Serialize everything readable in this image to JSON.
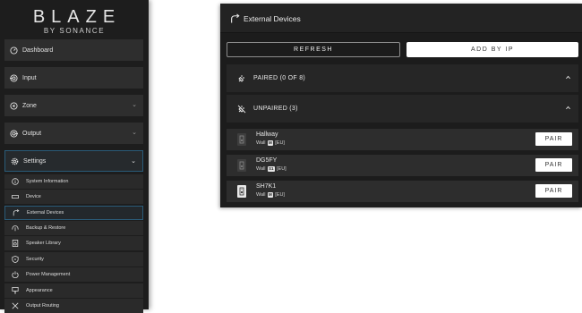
{
  "sidebar": {
    "logo": {
      "brand": "BLAZE",
      "sub": "BY SONANCE"
    },
    "nav": [
      {
        "label": "Dashboard",
        "icon": "dashboard-icon"
      },
      {
        "label": "Input",
        "icon": "input-icon"
      },
      {
        "label": "Zone",
        "icon": "zone-icon",
        "has_chevron": true
      },
      {
        "label": "Output",
        "icon": "output-icon",
        "has_chevron": true
      },
      {
        "label": "Settings",
        "icon": "settings-gear-icon",
        "has_chevron": true,
        "expanded": true
      }
    ],
    "settings_items": [
      {
        "label": "System Information",
        "icon": "info-icon"
      },
      {
        "label": "Device",
        "icon": "device-icon"
      },
      {
        "label": "External Devices",
        "icon": "external-devices-icon",
        "active": true
      },
      {
        "label": "Backup & Restore",
        "icon": "backup-restore-icon"
      },
      {
        "label": "Speaker Library",
        "icon": "speaker-library-icon"
      },
      {
        "label": "Security",
        "icon": "security-shield-icon"
      },
      {
        "label": "Power Management",
        "icon": "power-icon"
      },
      {
        "label": "Appearance",
        "icon": "appearance-icon"
      },
      {
        "label": "Output Routing",
        "icon": "output-routing-icon"
      }
    ]
  },
  "panel": {
    "title": "External Devices",
    "refresh_label": "REFRESH",
    "add_by_ip_label": "ADD BY IP",
    "paired_label": "PAIRED (0 OF 8)",
    "unpaired_label": "UNPAIRED (3)",
    "devices": [
      {
        "name": "Hallway",
        "type": "Wall",
        "tag": "M",
        "region": "[EU]",
        "pair_label": "PAIR"
      },
      {
        "name": "DG5FY",
        "type": "Wall",
        "tag": "S1",
        "region": "[EU]",
        "pair_label": "PAIR"
      },
      {
        "name": "SH7K1",
        "type": "Wall",
        "tag": "M",
        "region": "[EU]",
        "pair_label": "PAIR"
      }
    ]
  }
}
